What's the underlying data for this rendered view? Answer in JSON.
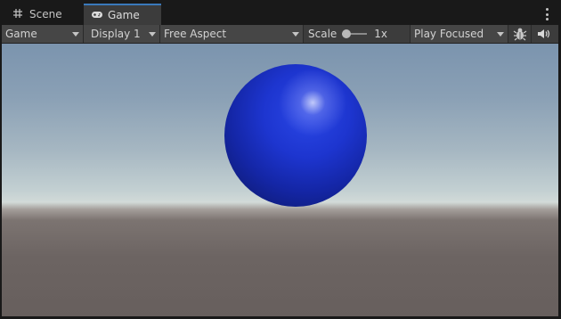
{
  "tabs": [
    {
      "label": "Scene",
      "icon": "grid-icon",
      "active": false
    },
    {
      "label": "Game",
      "icon": "gamepad-icon",
      "active": true
    }
  ],
  "toolbar": {
    "view_mode": "Game",
    "display": "Display 1",
    "aspect": "Free Aspect",
    "scale_label": "Scale",
    "scale_value": "1x",
    "scale_level": 0,
    "play_mode": "Play Focused",
    "bug_icon": "bug-icon",
    "audio_icon": "speaker-icon"
  },
  "colors": {
    "accent": "#3a79bb",
    "sphere": "#1d35cf",
    "panel": "#3c3c3c",
    "background": "#191919"
  }
}
